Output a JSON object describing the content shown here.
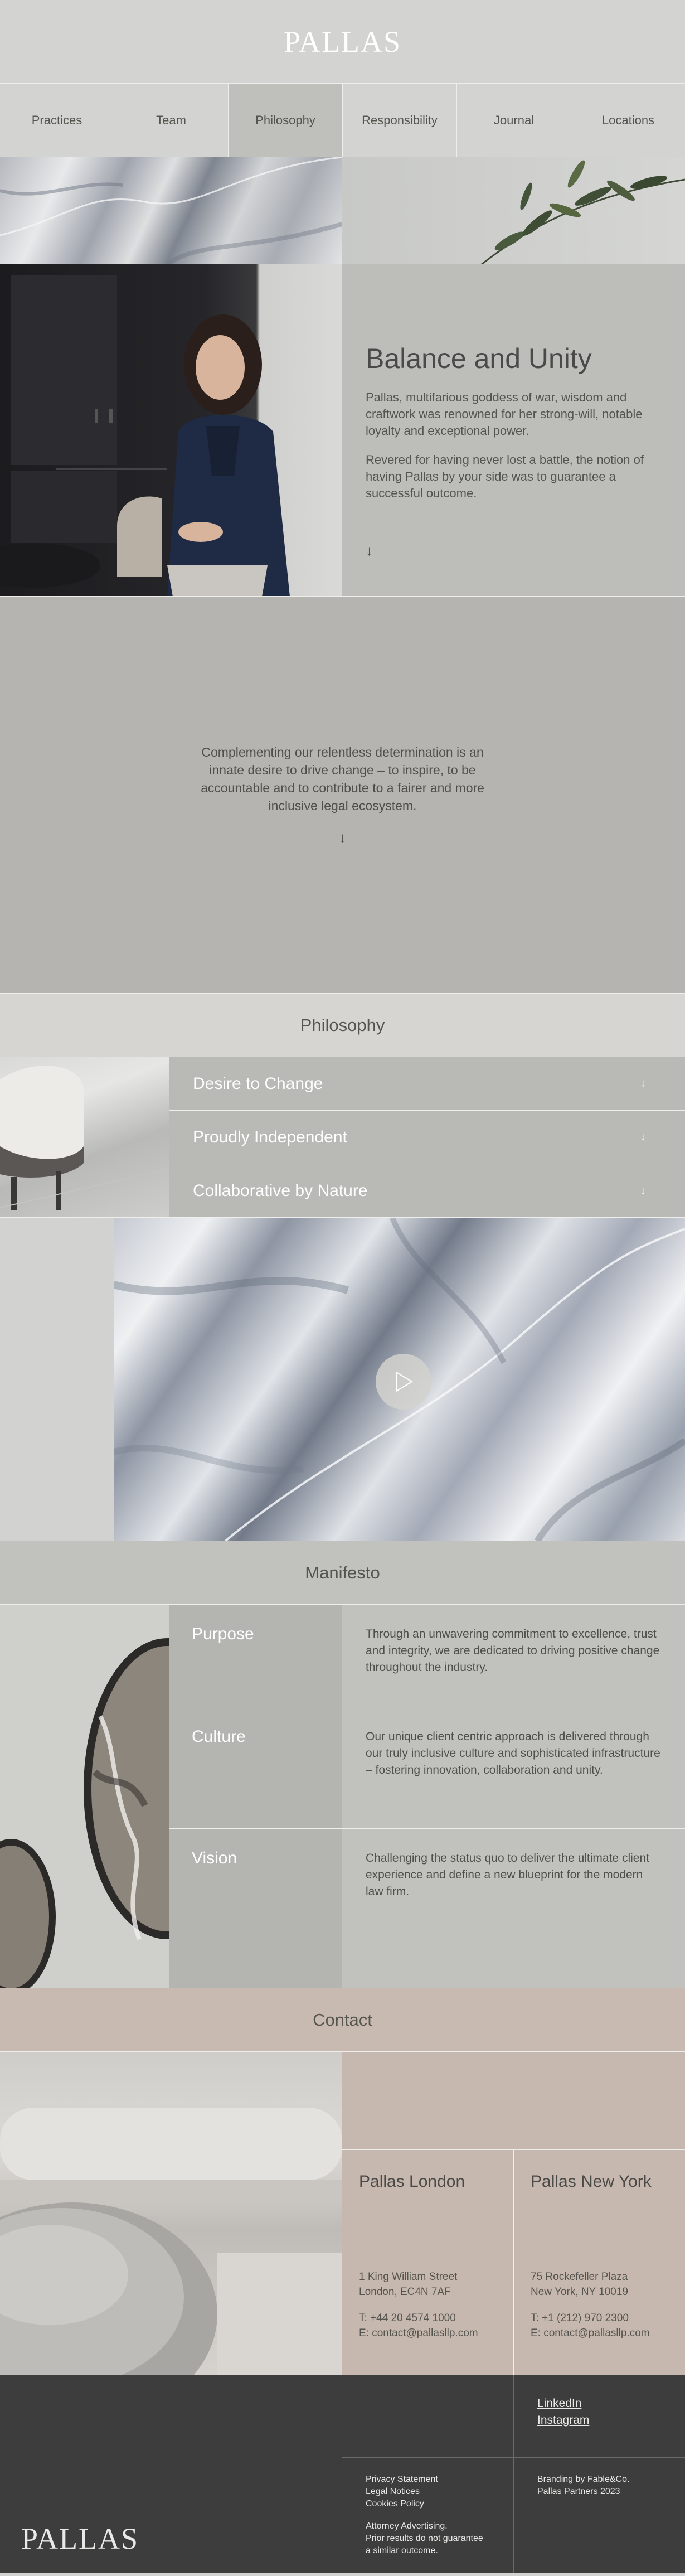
{
  "brand": {
    "logo": "PALLAS"
  },
  "nav": {
    "items": [
      {
        "label": "Practices"
      },
      {
        "label": "Team"
      },
      {
        "label": "Philosophy"
      },
      {
        "label": "Responsibility"
      },
      {
        "label": "Journal"
      },
      {
        "label": "Locations"
      }
    ],
    "active": "Philosophy"
  },
  "intro": {
    "title": "Balance and Unity",
    "p1": "Pallas, multifarious goddess of war, wisdom and craftwork was renowned for her strong-will, notable loyalty and exceptional power.",
    "p2": "Revered for having never lost a battle, the notion of having Pallas by your side was to guarantee a successful outcome.",
    "arrow": "↓"
  },
  "statement": {
    "text": "Complementing our relentless determination is an innate desire to drive change – to inspire, to be accountable and to contribute to a fairer and more inclusive legal ecosystem.",
    "arrow": "↓"
  },
  "philosophy": {
    "heading": "Philosophy",
    "items": [
      {
        "label": "Desire to Change",
        "chevron": "↓"
      },
      {
        "label": "Proudly Independent",
        "chevron": "↓"
      },
      {
        "label": "Collaborative by Nature",
        "chevron": "↓"
      }
    ]
  },
  "manifesto": {
    "heading": "Manifesto",
    "rows": [
      {
        "label": "Purpose",
        "text": "Through an unwavering commitment to excellence, trust and integrity, we are dedicated to driving positive change throughout the industry."
      },
      {
        "label": "Culture",
        "text": "Our unique client centric approach is delivered through our truly inclusive culture and sophisticated infrastructure – fostering innovation, collaboration and unity."
      },
      {
        "label": "Vision",
        "text": "Challenging the status quo to deliver the ultimate client experience and define a new blueprint for the modern law firm."
      }
    ]
  },
  "contact": {
    "heading": "Contact",
    "offices": [
      {
        "name": "Pallas London",
        "address1": "1 King William Street",
        "address2": "London, EC4N 7AF",
        "phone": "T: +44 20 4574 1000",
        "email": "E: contact@pallasllp.com"
      },
      {
        "name": "Pallas New York",
        "address1": "75 Rockefeller Plaza",
        "address2": "New York, NY 10019",
        "phone": "T: +1 (212) 970 2300",
        "email": "E: contact@pallasllp.com"
      }
    ]
  },
  "footer": {
    "logo": "PALLAS",
    "social": [
      "LinkedIn",
      "Instagram"
    ],
    "legal": [
      "Privacy Statement",
      "Legal Notices",
      "Cookies Policy"
    ],
    "attorney1": "Attorney Advertising.",
    "attorney2": "Prior results do not guarantee a similar outcome.",
    "credit1": "Branding by Fable&Co.",
    "credit2": "Pallas Partners 2023"
  },
  "colors": {
    "accent": "#ffffff",
    "nav_active": "#bfbfbb",
    "footer_bg": "#3d3d3d"
  }
}
